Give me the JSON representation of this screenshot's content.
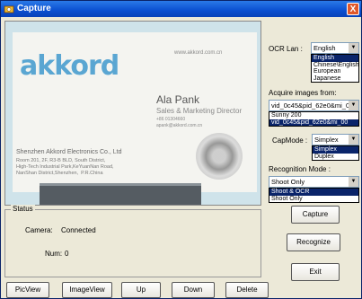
{
  "window": {
    "title": "Capture",
    "close_label": "X"
  },
  "card": {
    "logo": "akkord",
    "web": "www.akkord.com.cn",
    "person_name": "Ala Pank",
    "person_title": "Sales & Marketing Director",
    "person_contact": "+86 01304660\napank@akkord.com.cn",
    "company": "Shenzhen Akkord Electronics Co., Ltd",
    "address": "Room 201, 2F, R3-B BLD, South District,\nHigh-Tech Industrial Park,KeYuanNan Road,\nNanShan District,Shenzhen,  P.R.China"
  },
  "ocr": {
    "label": "OCR Lan :",
    "selected": "English",
    "options": [
      "English",
      "Chinese\\English",
      "European",
      "Japanese"
    ],
    "highlighted_index": 0
  },
  "acquire": {
    "label": "Acquire images from:",
    "selected": "vid_0c45&pid_62e0&mi_00",
    "options": [
      "Sunny 200",
      "vid_0c45&pid_62e0&mi_00"
    ],
    "highlighted_index": 1
  },
  "capmode": {
    "label": "CapMode :",
    "selected": "Simplex",
    "options": [
      "Simplex",
      "Duplex"
    ],
    "highlighted_index": 0
  },
  "recognition": {
    "label": "Recognition Mode :",
    "selected": "Shoot Only",
    "options": [
      "Shoot & OCR",
      "Shoot Only"
    ],
    "highlighted_index": 0
  },
  "status": {
    "legend": "Status",
    "camera_label": "Camera:",
    "camera_value": "Connected",
    "num_label": "Num:",
    "num_value": "0"
  },
  "buttons": {
    "capture": "Capture",
    "recognize": "Recognize",
    "exit": "Exit",
    "picview": "PicView",
    "imageview": "ImageView",
    "up": "Up",
    "down": "Down",
    "delete": "Delete"
  },
  "colors": {
    "title_bar": "#0a4fd0",
    "selection": "#0a246a",
    "logo": "#5aa6d2"
  }
}
